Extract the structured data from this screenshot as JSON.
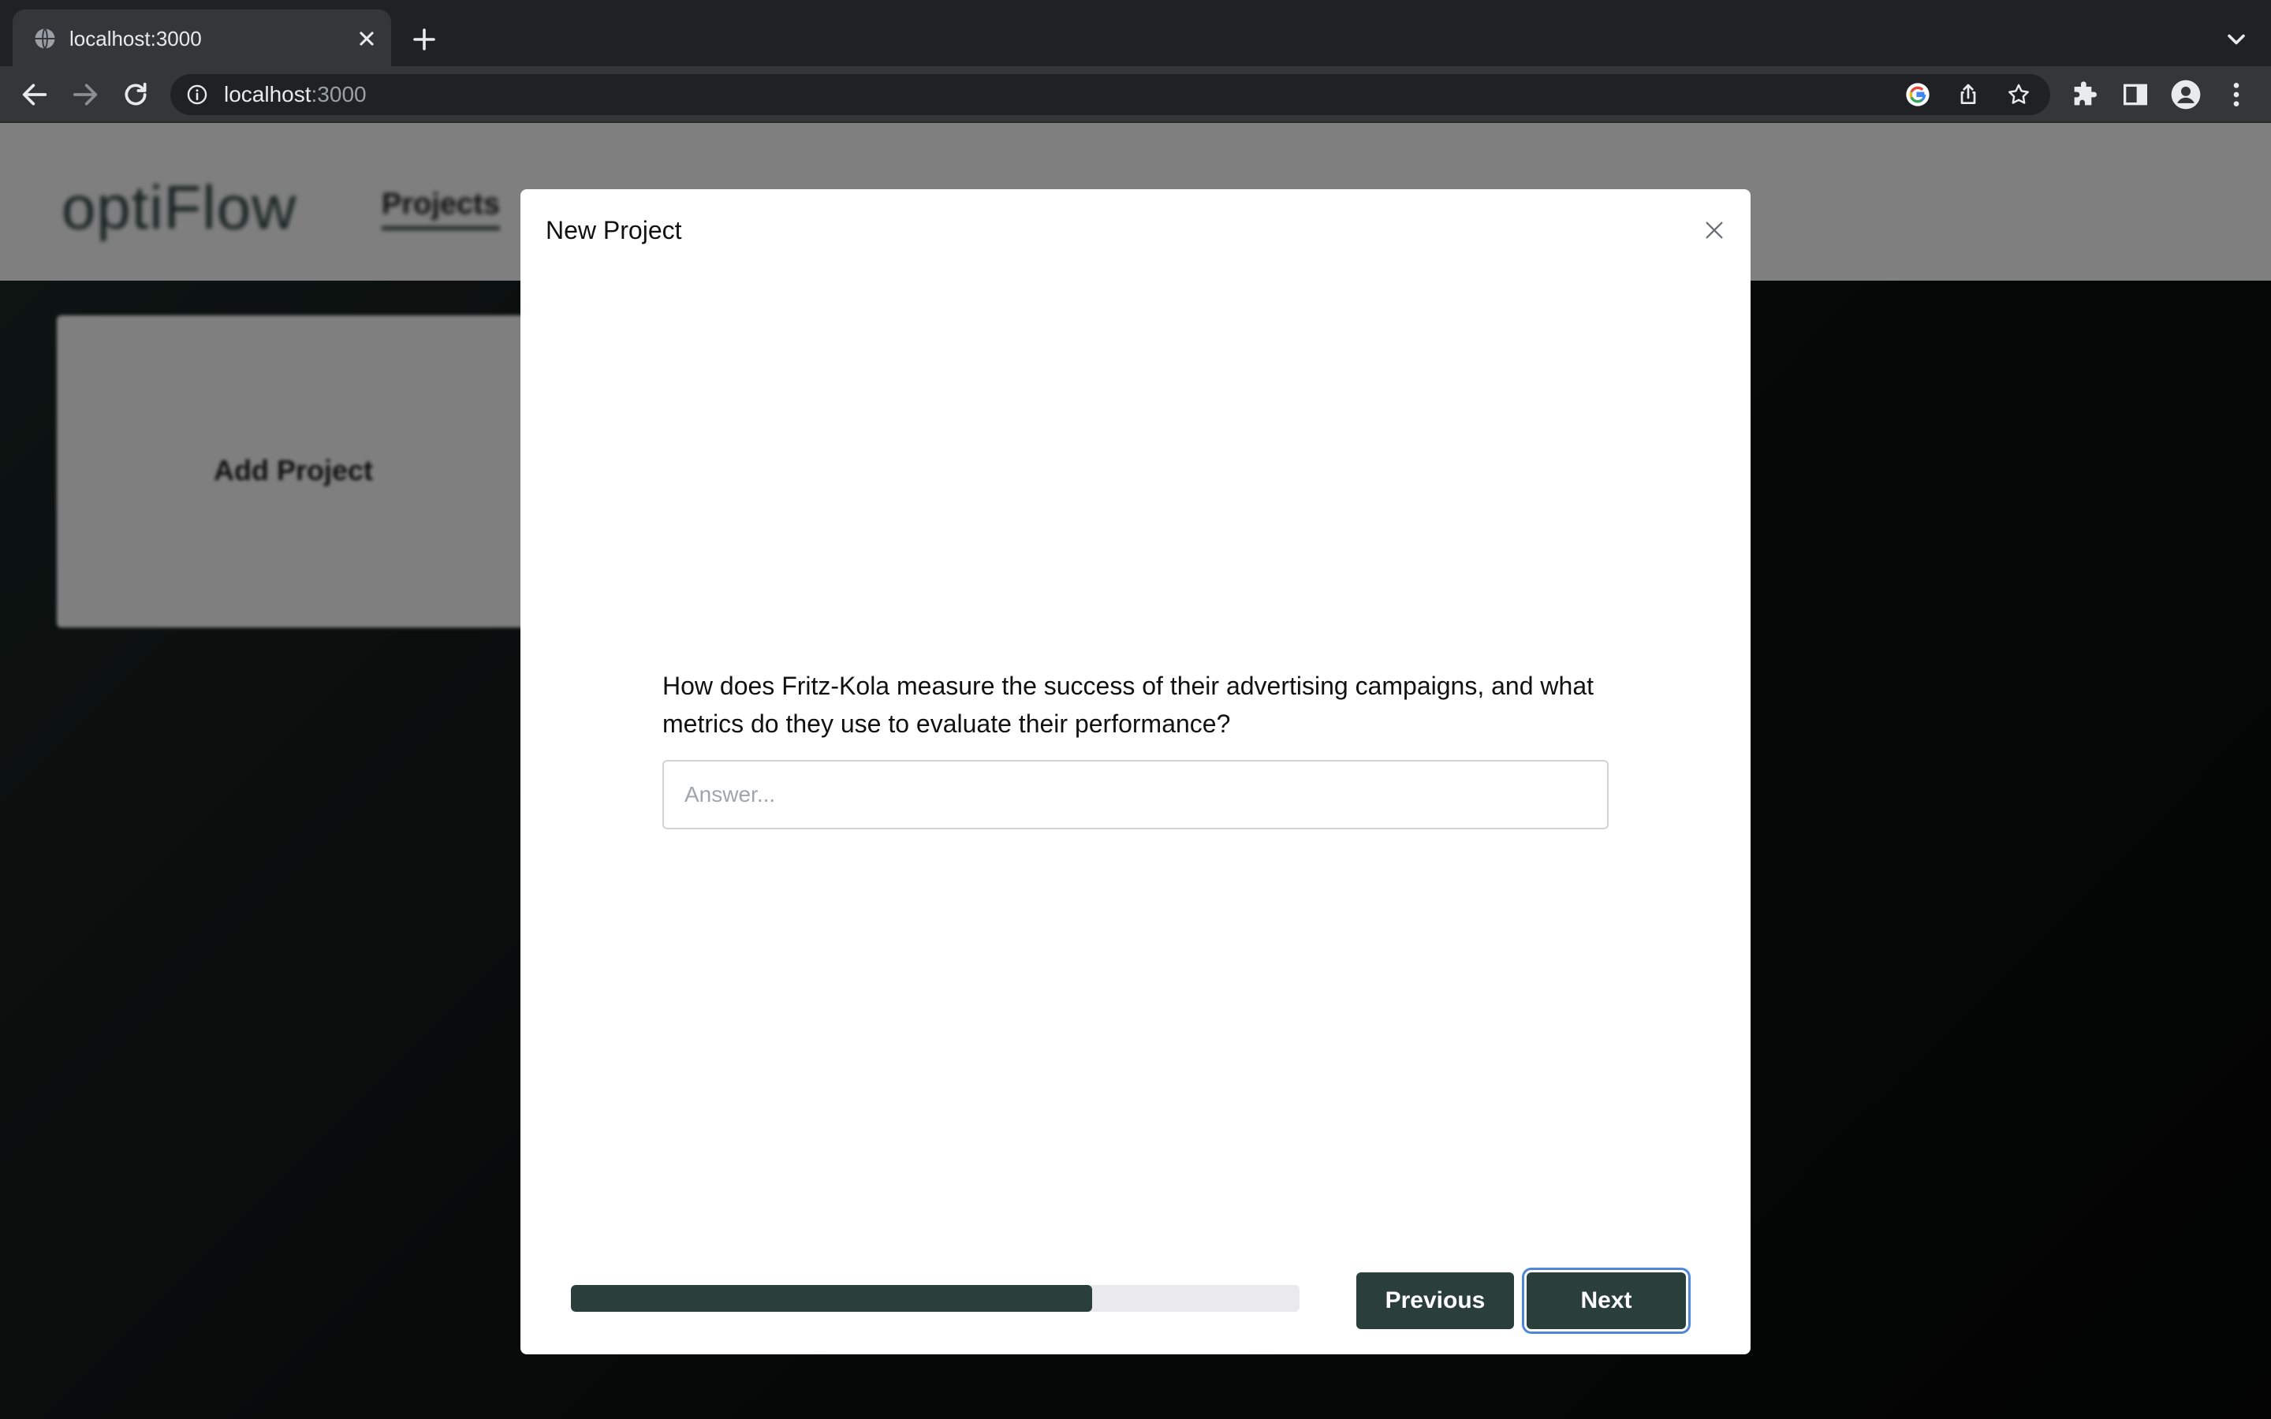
{
  "browser": {
    "tab_title": "localhost:3000",
    "url_host": "localhost",
    "url_port": ":3000",
    "icons": [
      "globe-icon",
      "close-icon",
      "plus-icon",
      "chevron-down-icon",
      "back-arrow-icon",
      "forward-arrow-icon",
      "reload-icon",
      "info-icon",
      "google-icon",
      "share-icon",
      "star-icon",
      "puzzle-icon",
      "side-panel-icon",
      "profile-icon",
      "kebab-menu-icon"
    ]
  },
  "app": {
    "logo": "optiFlow",
    "nav_projects": "Projects",
    "add_project": "Add Project"
  },
  "modal": {
    "title": "New Project",
    "question": "How does Fritz-Kola measure the success of their advertising campaigns, and what metrics do they use to evaluate their performance?",
    "answer_placeholder": "Answer...",
    "answer_value": "",
    "progress_fraction": 0.715,
    "previous_label": "Previous",
    "next_label": "Next"
  },
  "colors": {
    "accent": "#2b3f3a",
    "focus_ring": "#4f86d9",
    "progress_track": "#eaeaed"
  }
}
